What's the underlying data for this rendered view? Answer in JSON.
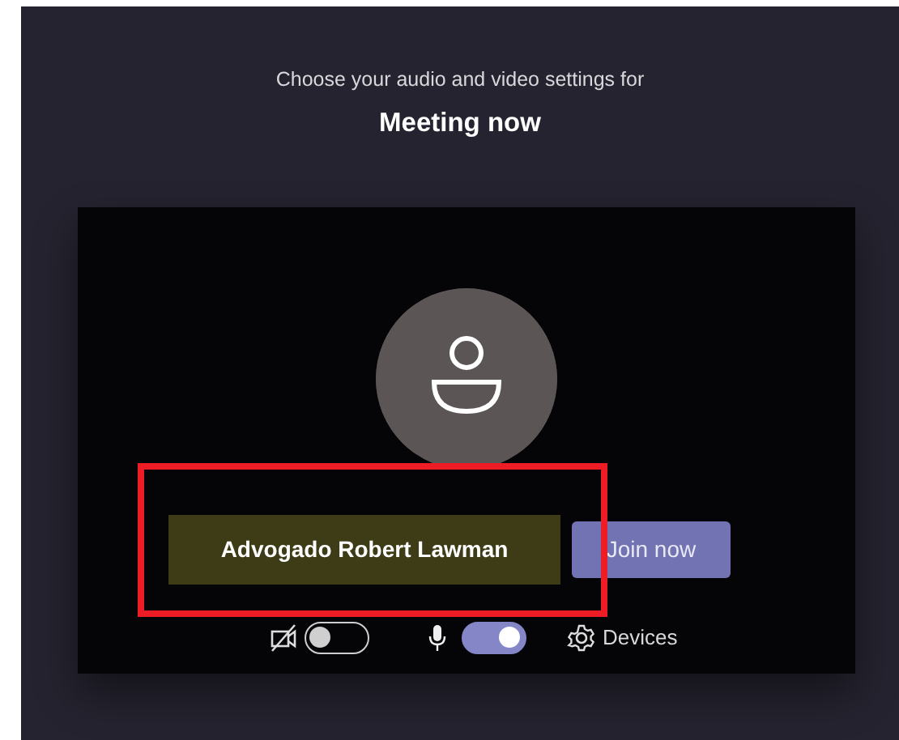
{
  "header": {
    "subtitle": "Choose your audio and video settings for",
    "meeting_title": "Meeting now"
  },
  "preview": {
    "name_tag": "Advogado Robert Lawman",
    "join_button": "Join now"
  },
  "controls": [
    {
      "kind": "camera",
      "on": false
    },
    {
      "kind": "mic",
      "on": true
    },
    {
      "kind": "devices",
      "label": "Devices"
    }
  ]
}
